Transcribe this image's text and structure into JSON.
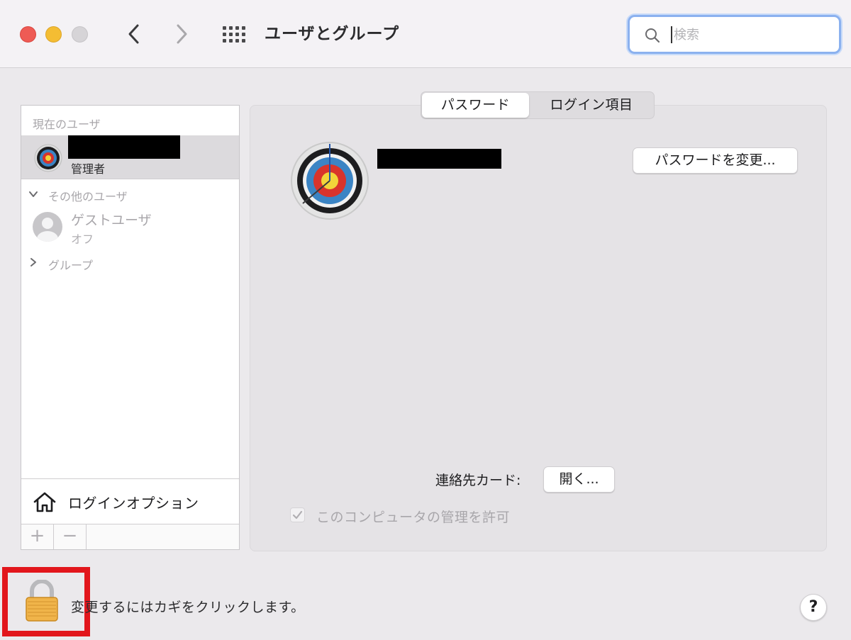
{
  "window": {
    "title": "ユーザとグループ",
    "search_placeholder": "検索"
  },
  "sidebar": {
    "current_users_label": "現在のユーザ",
    "current_user": {
      "name_redacted": true,
      "role": "管理者",
      "avatar": "archery-target-icon"
    },
    "other_users_label": "その他のユーザ",
    "guest_user": {
      "name": "ゲストユーザ",
      "status": "オフ"
    },
    "groups_label": "グループ",
    "login_options_label": "ログインオプション",
    "add_button": "+",
    "remove_button": "−"
  },
  "tabs": [
    {
      "label": "パスワード",
      "active": true
    },
    {
      "label": "ログイン項目",
      "active": false
    }
  ],
  "main": {
    "change_password_button": "パスワードを変更...",
    "contact_card_label": "連絡先カード:",
    "open_button": "開く...",
    "admin_checkbox_label": "このコンピュータの管理を許可",
    "admin_checkbox_checked": true
  },
  "footer": {
    "lock_text": "変更するにはカギをクリックします。",
    "help_button": "?"
  },
  "colors": {
    "highlight_box": "#e2161c",
    "search_focus": "#8bb1ef"
  }
}
